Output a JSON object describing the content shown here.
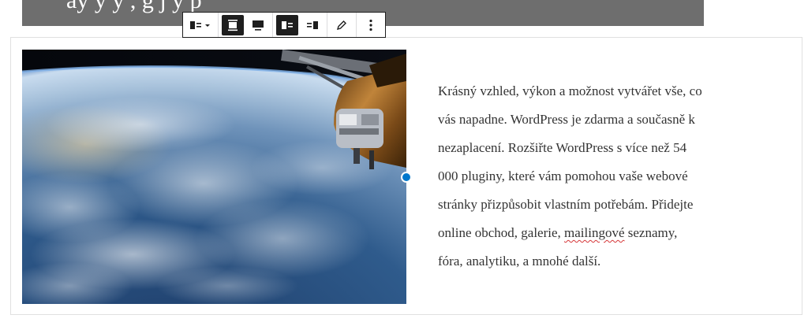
{
  "top_strip": {
    "text": "ay  y  y          ,  g      j  y  p"
  },
  "toolbar": {
    "buttons": [
      {
        "name": "block-type-switcher",
        "icon": "media-text-icon"
      },
      {
        "name": "align-wide",
        "icon": "align-wide-icon"
      },
      {
        "name": "align-full",
        "icon": "align-full-icon"
      },
      {
        "name": "media-left",
        "icon": "media-left-icon"
      },
      {
        "name": "media-right",
        "icon": "media-right-icon"
      },
      {
        "name": "edit-image",
        "icon": "pencil-icon"
      },
      {
        "name": "more-options",
        "icon": "more-vertical-icon"
      }
    ]
  },
  "content": {
    "lines": [
      "Krásný vzhled, výkon a možnost vytvářet vše, co",
      "vás napadne. WordPress je zdarma a současně k",
      "nezaplacení. Rozšiřte WordPress s více než 54",
      "000 pluginy, které vám pomohou vaše webové",
      "stránky přizpůsobit vlastním potřebám. Přidejte",
      "online obchod, galerie, ",
      "mailingové",
      " seznamy,",
      "fóra, analytiku, a mnohé další."
    ]
  },
  "colors": {
    "strip": "#6e6e6e",
    "handle": "#0077cc",
    "toolbar_active": "#1e1e1e"
  }
}
